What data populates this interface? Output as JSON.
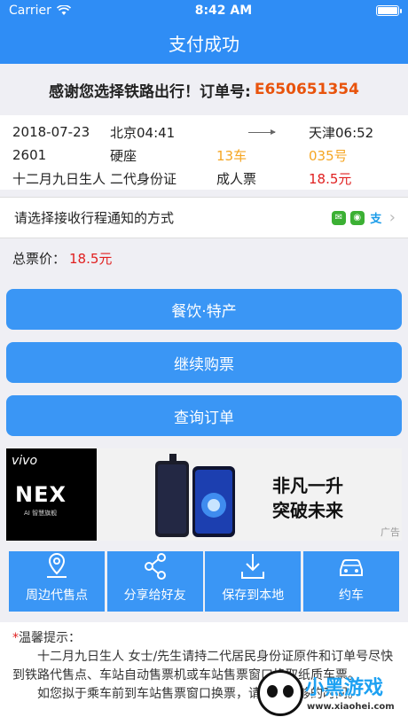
{
  "status": {
    "carrier": "Carrier",
    "time": "8:42 AM"
  },
  "nav": {
    "title": "支付成功"
  },
  "thanks": {
    "text": "感谢您选择铁路出行！订单号:",
    "order_no": "E650651354"
  },
  "ticket": {
    "date": "2018-07-23",
    "from": "北京04:41",
    "to": "天津06:52",
    "train": "2601",
    "seat_type": "硬座",
    "car": "13车",
    "seat_no": "035号",
    "passenger": "十二月九日生人",
    "id_type": "二代身份证",
    "ticket_type": "成人票",
    "price": "18.5元"
  },
  "notify": {
    "label": "请选择接收行程通知的方式",
    "icons": [
      "message-icon",
      "wechat-icon",
      "alipay-icon"
    ]
  },
  "total": {
    "label": "总票价：",
    "value": "18.5元"
  },
  "buttons": {
    "food": "餐饮·特产",
    "continue": "继续购票",
    "query": "查询订单"
  },
  "ad": {
    "brand": "vivo",
    "product": "NEX",
    "product_sub": "AI 智慧旗舰",
    "slogan_line1": "非凡一升",
    "slogan_line2": "突破未来",
    "tag": "广告"
  },
  "shares": [
    {
      "label": "周边代售点",
      "icon": "location-icon"
    },
    {
      "label": "分享给好友",
      "icon": "share-icon"
    },
    {
      "label": "保存到本地",
      "icon": "download-icon"
    },
    {
      "label": "约车",
      "icon": "car-icon"
    }
  ],
  "tips": {
    "title": "温馨提示：",
    "p1": "十二月九日生人 女士/先生请持二代居民身份证原件和订单号尽快到铁路代售点、车站自动售票机或车站售票窗口换取纸质车票。",
    "p2": "如您拟于乘车前到车站售票窗口换票，请预留足够的时间。"
  },
  "watermark": {
    "brand": "小黑游戏",
    "url": "www.xiaohei.com"
  },
  "colors": {
    "primary": "#2f8df5",
    "button": "#3a96f5",
    "price": "#e02020",
    "seat": "#f5a623",
    "order": "#e8530c"
  }
}
